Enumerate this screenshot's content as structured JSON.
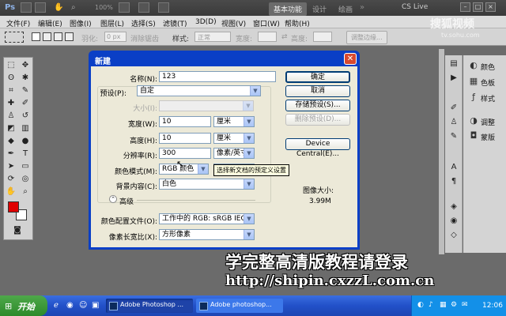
{
  "app": {
    "logo": "Ps",
    "workspace": "基本功能",
    "ws_design": "设计",
    "ws_paint": "绘画",
    "cs_live": "CS Live",
    "zoom": "100%"
  },
  "menu": [
    "文件(F)",
    "编辑(E)",
    "图像(I)",
    "图层(L)",
    "选择(S)",
    "滤镜(T)",
    "3D(D)",
    "视图(V)",
    "窗口(W)",
    "帮助(H)"
  ],
  "options": {
    "feather_label": "羽化:",
    "feather_value": "0 px",
    "antialias": "消除锯齿",
    "style_label": "样式:",
    "style_value": "正常",
    "width_label": "宽度:",
    "height_label": "高度:",
    "refine": "调整边缘..."
  },
  "watermark": {
    "top": "搜狐视频",
    "sub": "tv.sohu.com",
    "line1": "学完整高清版教程请登录",
    "line2": "http://shipin.cxzzL.com.cn"
  },
  "dialog": {
    "title": "新建",
    "name_label": "名称(N):",
    "name_value": "123",
    "preset_label": "预设(P):",
    "preset_value": "自定",
    "size_label": "大小(I):",
    "width_label": "宽度(W):",
    "width_value": "10",
    "width_unit": "厘米",
    "height_label": "高度(H):",
    "height_value": "10",
    "height_unit": "厘米",
    "res_label": "分辨率(R):",
    "res_value": "300",
    "res_unit": "像素/英寸",
    "mode_label": "颜色模式(M):",
    "mode_value": "RGB 颜色",
    "depth_value": "8 位",
    "bg_label": "背景内容(C):",
    "bg_value": "白色",
    "advanced": "高级",
    "profile_label": "颜色配置文件(O):",
    "profile_value": "工作中的 RGB: sRGB IEC6...",
    "aspect_label": "像素长宽比(X):",
    "aspect_value": "方形像素",
    "tooltip": "选择新文档的预定义设置",
    "ok": "确定",
    "cancel": "取消",
    "save_preset": "存储预设(S)...",
    "delete_preset": "删除预设(D)...",
    "device": "Device Central(E)...",
    "image_size_label": "图像大小:",
    "image_size_value": "3.99M"
  },
  "panels": {
    "colors": "颜色",
    "swatches": "色板",
    "styles": "样式",
    "adjust": "调整",
    "masks": "蒙版"
  },
  "taskbar": {
    "start": "开始",
    "task1": "Adobe Photoshop ...",
    "task2": "Adobe photoshop...",
    "time": "12:06"
  },
  "colors": {
    "fg": "#e00000",
    "bg": "#ffffff",
    "accent": "#0a3fc6"
  }
}
